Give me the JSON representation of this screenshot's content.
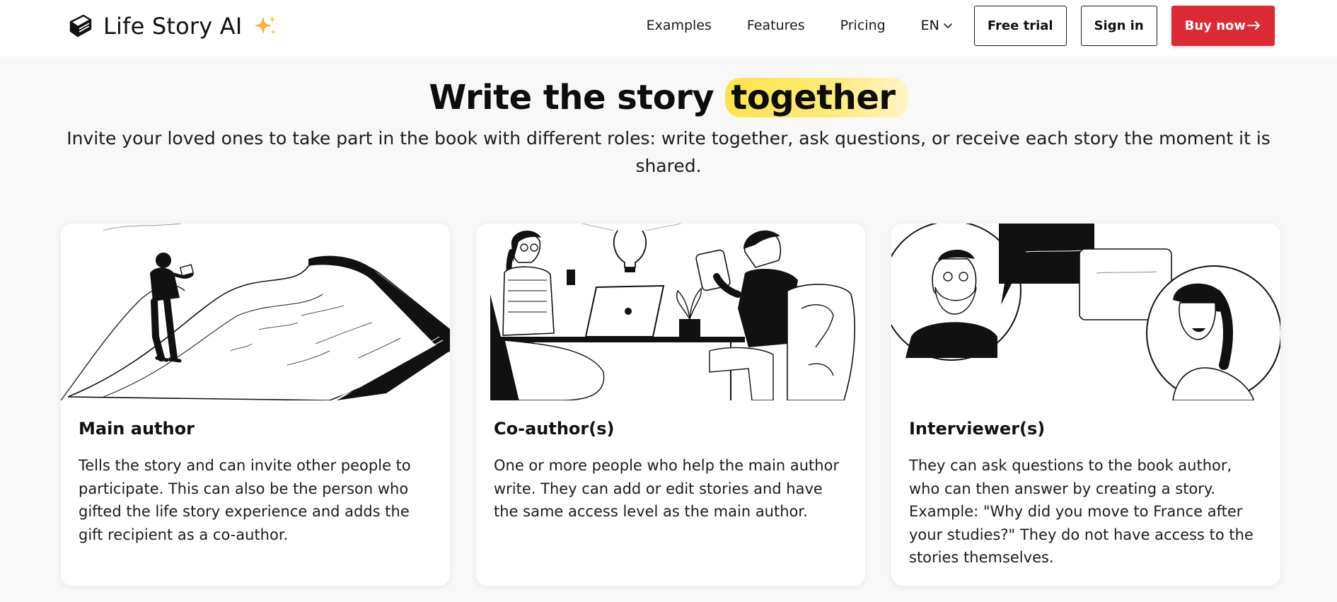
{
  "brand": {
    "name": "Life Story AI",
    "logo_icon": "book-icon",
    "sparkle_icon": "sparkles-icon"
  },
  "nav": {
    "items": [
      {
        "label": "Examples"
      },
      {
        "label": "Features"
      },
      {
        "label": "Pricing"
      }
    ],
    "language": {
      "label": "EN",
      "icon": "chevron-down-icon"
    },
    "free_trial_label": "Free trial",
    "sign_in_label": "Sign in",
    "buy_now_label": "Buy now",
    "buy_now_icon": "arrow-right-icon"
  },
  "hero": {
    "title_prefix": "Write the story ",
    "title_highlight": "together",
    "subtitle": "Invite your loved ones to take part in the book with different roles: write together, ask questions, or receive each story the moment it is shared."
  },
  "cards": [
    {
      "title": "Main author",
      "description": "Tells the story and can invite other people to participate. This can also be the person who gifted the life story experience and adds the gift recipient as a co-author.",
      "illustration": "person-walking-on-open-book-illustration"
    },
    {
      "title": "Co-author(s)",
      "description": "One or more people who help the main author write. They can add or edit stories and have the same access level as the main author.",
      "illustration": "two-people-writing-at-desk-illustration"
    },
    {
      "title": "Interviewer(s)",
      "description": "They can ask questions to the book author, who can then answer by creating a story. Example: \"Why did you move to France after your studies?\" They do not have access to the stories themselves.",
      "illustration": "two-people-chatting-illustration"
    }
  ],
  "colors": {
    "accent_red": "#dc2a35",
    "highlight_yellow": "#fde34a",
    "page_background": "#f8f8f8"
  }
}
